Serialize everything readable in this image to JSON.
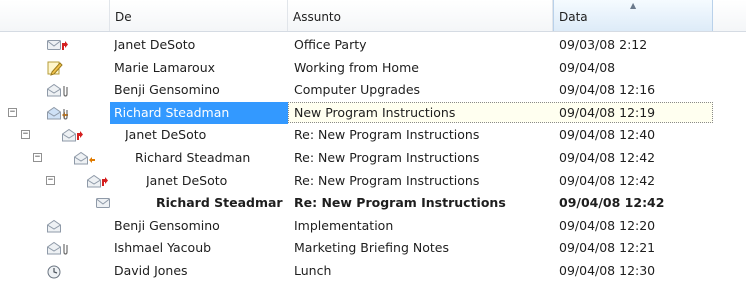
{
  "columns": {
    "from": "De",
    "subject": "Assunto",
    "date": "Data"
  },
  "messages": [
    {
      "from": "Janet DeSoto",
      "subject": "Office Party",
      "date": "09/03/08 2:12",
      "icon": "envelope-forward-icon",
      "level": 0,
      "toggle": null,
      "selected": false,
      "bold": false
    },
    {
      "from": "Marie Lamaroux",
      "subject": "Working from Home",
      "date": "09/04/08",
      "icon": "note-pencil-icon",
      "level": 0,
      "toggle": null,
      "selected": false,
      "bold": false
    },
    {
      "from": "Benji Gensomino",
      "subject": "Computer Upgrades",
      "date": "09/04/08 12:16",
      "icon": "open-envelope-attachment-icon",
      "level": 0,
      "toggle": null,
      "selected": false,
      "bold": false
    },
    {
      "from": "Richard Steadman",
      "subject": "New Program Instructions",
      "date": "09/04/08 12:19",
      "icon": "open-envelope-reply-attachment-icon",
      "level": 0,
      "toggle": "−",
      "selected": true,
      "bold": false
    },
    {
      "from": "Janet DeSoto",
      "subject": "Re: New Program Instructions",
      "date": "09/04/08 12:40",
      "icon": "open-envelope-forward-icon",
      "level": 1,
      "toggle": "−",
      "selected": false,
      "bold": false
    },
    {
      "from": "Richard Steadman",
      "subject": "Re: New Program Instructions",
      "date": "09/04/08 12:42",
      "icon": "open-envelope-reply-icon",
      "level": 2,
      "toggle": "−",
      "selected": false,
      "bold": false
    },
    {
      "from": "Janet DeSoto",
      "subject": "Re: New Program Instructions",
      "date": "09/04/08 12:42",
      "icon": "open-envelope-forward-icon",
      "level": 3,
      "toggle": "−",
      "selected": false,
      "bold": false
    },
    {
      "from": "Richard Steadmar",
      "subject": "Re: New Program Instructions",
      "date": "09/04/08 12:42",
      "icon": "closed-envelope-icon",
      "level": 4,
      "toggle": null,
      "selected": false,
      "bold": true
    },
    {
      "from": "Benji Gensomino",
      "subject": "Implementation",
      "date": "09/04/08 12:20",
      "icon": "open-envelope-icon",
      "level": 0,
      "toggle": null,
      "selected": false,
      "bold": false
    },
    {
      "from": "Ishmael Yacoub",
      "subject": "Marketing Briefing Notes",
      "date": "09/04/08 12:21",
      "icon": "open-envelope-attachment-icon",
      "level": 0,
      "toggle": null,
      "selected": false,
      "bold": false
    },
    {
      "from": "David Jones",
      "subject": "Lunch",
      "date": "09/04/08 12:30",
      "icon": "clock-icon",
      "level": 0,
      "toggle": null,
      "selected": false,
      "bold": false
    }
  ],
  "colors": {
    "selection": "#3399ff",
    "forward_arrow": "#d42020",
    "reply_arrow": "#e07b00",
    "envelope": "#8f9aa8"
  }
}
